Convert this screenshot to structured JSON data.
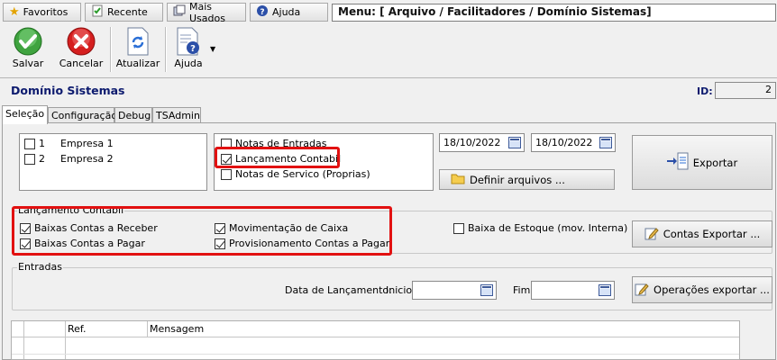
{
  "shortcuts": {
    "favoritos": "Favoritos",
    "recente": "Recente",
    "mais_usados": "Mais Usados",
    "ajuda": "Ajuda"
  },
  "menu_path": "Menu: [ Arquivo / Facilitadores / Domínio Sistemas]",
  "toolbar": {
    "salvar": "Salvar",
    "cancelar": "Cancelar",
    "atualizar": "Atualizar",
    "ajuda": "Ajuda"
  },
  "header": {
    "title": "Domínio Sistemas",
    "id_label": "ID:",
    "id_value": "2"
  },
  "tabs": [
    "Seleção",
    "Configuração",
    "Debug",
    "TSAdmin"
  ],
  "empresas": [
    {
      "num": "1",
      "name": "Empresa 1",
      "checked": false
    },
    {
      "num": "2",
      "name": "Empresa 2",
      "checked": false
    }
  ],
  "options": [
    {
      "label": "Notas de Entradas",
      "checked": false
    },
    {
      "label": "Lançamento Contabil",
      "checked": true
    },
    {
      "label": "Notas de Servico (Proprias)",
      "checked": false
    }
  ],
  "date_start": "18/10/2022",
  "date_end": "18/10/2022",
  "buttons": {
    "exportar": "Exportar",
    "definir_arquivos": "Definir arquivos ...",
    "contas_exportar": "Contas Exportar ...",
    "operacoes_exportar": "Operações exportar ..."
  },
  "lancamento": {
    "group_label": "Lançamento Contabil",
    "baixas_receber": "Baixas Contas a Receber",
    "baixas_pagar": "Baixas Contas a Pagar",
    "movimentacao_caixa": "Movimentação de Caixa",
    "provisionamento": "Provisionamento Contas a Pagar",
    "baixa_estoque": "Baixa de Estoque (mov. Interna)"
  },
  "entradas": {
    "group_label": "Entradas",
    "data_lancamento": "Data de Lançamento:",
    "inicio": "Inicio",
    "fim": "Fim",
    "inicio_value": "",
    "fim_value": ""
  },
  "grid": {
    "columns": [
      "",
      "",
      "Ref.",
      "Mensagem"
    ]
  },
  "colors": {
    "highlight": "#e21111",
    "title": "#0c1a6e"
  }
}
